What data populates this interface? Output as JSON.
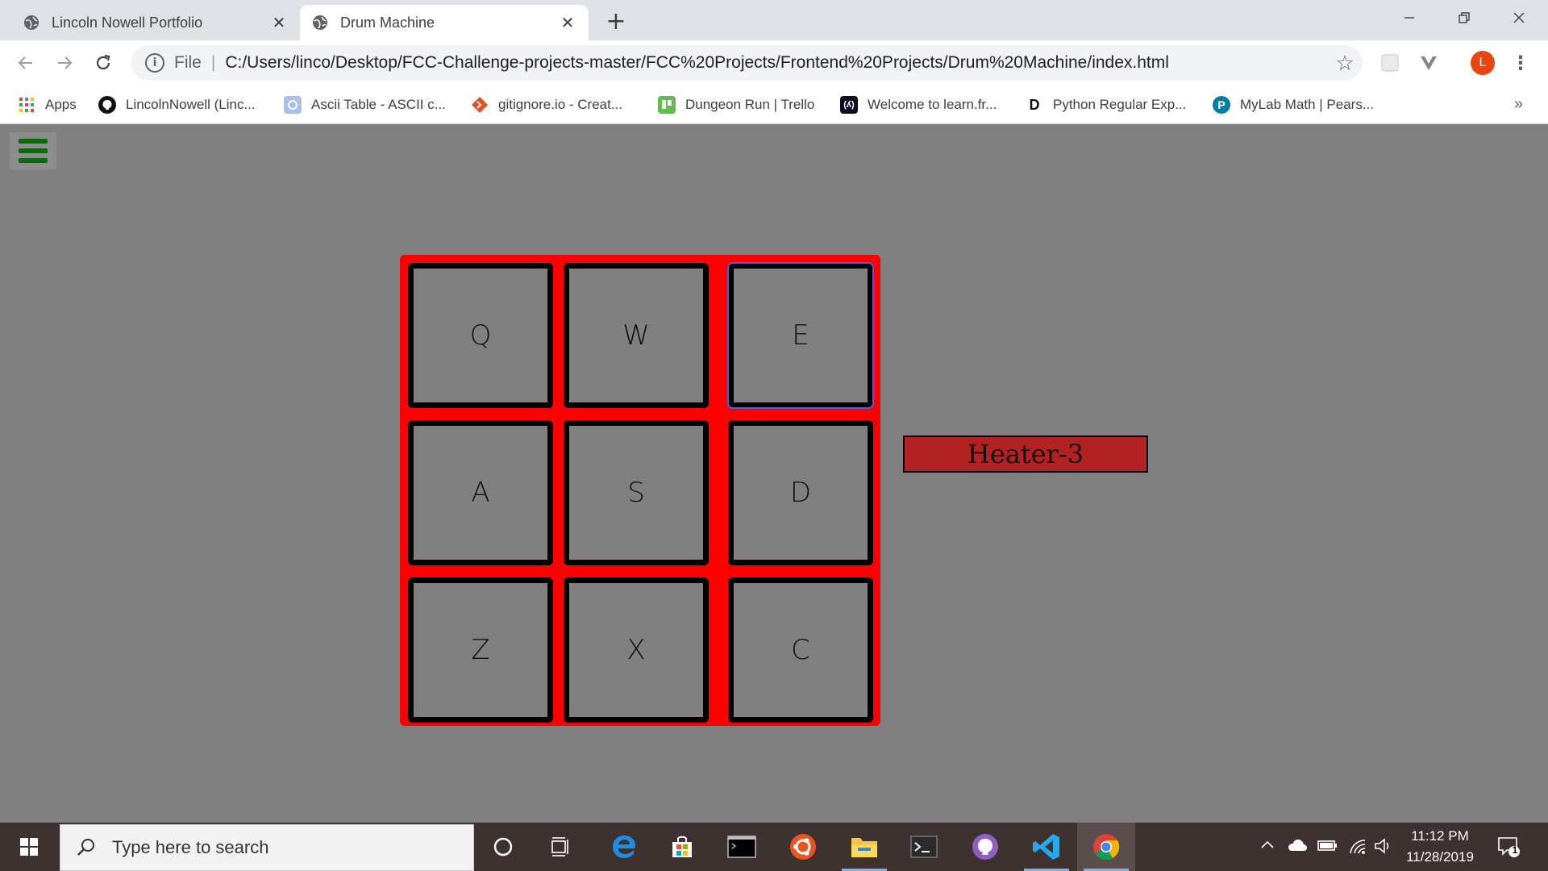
{
  "browser": {
    "tabs": [
      {
        "title": "Lincoln Nowell Portfolio",
        "active": false
      },
      {
        "title": "Drum Machine",
        "active": true
      }
    ],
    "new_tab_label": "+",
    "url_scheme": "File",
    "url": "C:/Users/linco/Desktop/FCC-Challenge-projects-master/FCC%20Projects/Frontend%20Projects/Drum%20Machine/index.html",
    "avatar_letter": "L",
    "bookmarks": [
      {
        "label": "Apps",
        "icon": "apps-grid-icon"
      },
      {
        "label": "LincolnNowell (Linc...",
        "icon": "github-icon"
      },
      {
        "label": "Ascii Table - ASCII c...",
        "icon": "ascii-table-icon"
      },
      {
        "label": "gitignore.io - Creat...",
        "icon": "gitignore-icon"
      },
      {
        "label": "Dungeon Run | Trello",
        "icon": "trello-icon"
      },
      {
        "label": "Welcome to learn.fr...",
        "icon": "freecodecamp-icon"
      },
      {
        "label": "Python Regular Exp...",
        "icon": "python-d-icon"
      },
      {
        "label": "MyLab Math | Pears...",
        "icon": "pearson-icon"
      }
    ],
    "bookmarks_overflow": "»"
  },
  "page": {
    "pads": [
      "Q",
      "W",
      "E",
      "A",
      "S",
      "D",
      "Z",
      "X",
      "C"
    ],
    "display_text": "Heater-3",
    "colors": {
      "background": "#808080",
      "pad_container": "#ff0000",
      "display": "#b22222",
      "hamburger": "#0a6b0a"
    }
  },
  "taskbar": {
    "search_placeholder": "Type here to search",
    "time": "11:12 PM",
    "date": "11/28/2019",
    "notification_count": "1"
  }
}
